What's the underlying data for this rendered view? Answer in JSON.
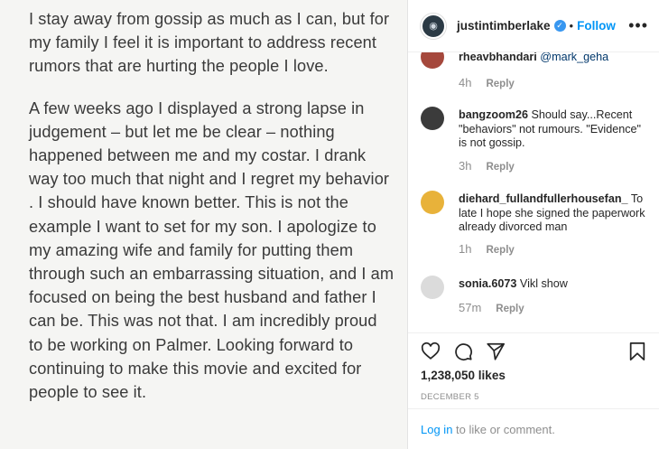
{
  "post": {
    "paragraphs": [
      "I stay away from gossip as much as I can, but for my family I feel it is important to address recent rumors that are hurting the people I love.",
      "A few weeks ago I displayed a strong lapse in judgement – but let me be clear – nothing happened between me and my costar. I drank way too much that night and I regret my behavior . I should have known better. This is not the example I want to set for my son. I apologize to my amazing wife and family for putting them through such an embarrassing situation, and I am focused on being the best husband and father I can be. This was not that. I am incredibly proud to be working on Palmer. Looking forward to continuing to make this movie and excited for people to see it."
    ]
  },
  "header": {
    "username": "justintimberlake",
    "verified_glyph": "✓",
    "separator": "•",
    "follow_label": "Follow",
    "more_glyph": "•••"
  },
  "comments": [
    {
      "username": "rheavbhandari",
      "text": "@mark_geha",
      "time": "4h",
      "reply": "Reply",
      "avatar_color": "#a5483c"
    },
    {
      "username": "bangzoom26",
      "text": "Should say...Recent \"behaviors\" not rumours. \"Evidence\" is not gossip.",
      "time": "3h",
      "reply": "Reply",
      "avatar_color": "#3b3b3b"
    },
    {
      "username": "diehard_fullandfullerhousefan_",
      "text": "To late I hope she signed the paperwork already divorced man",
      "time": "1h",
      "reply": "Reply",
      "avatar_color": "#e8b23a"
    },
    {
      "username": "sonia.6073",
      "text": "Vikl show",
      "time": "57m",
      "reply": "Reply",
      "avatar_color": "#dbdbdb"
    }
  ],
  "stats": {
    "likes": "1,238,050 likes",
    "date": "DECEMBER 5"
  },
  "login": {
    "link": "Log in",
    "rest": " to like or comment."
  },
  "colors": {
    "accent": "#0095f6",
    "muted": "#8e8e8e",
    "text": "#262626"
  }
}
